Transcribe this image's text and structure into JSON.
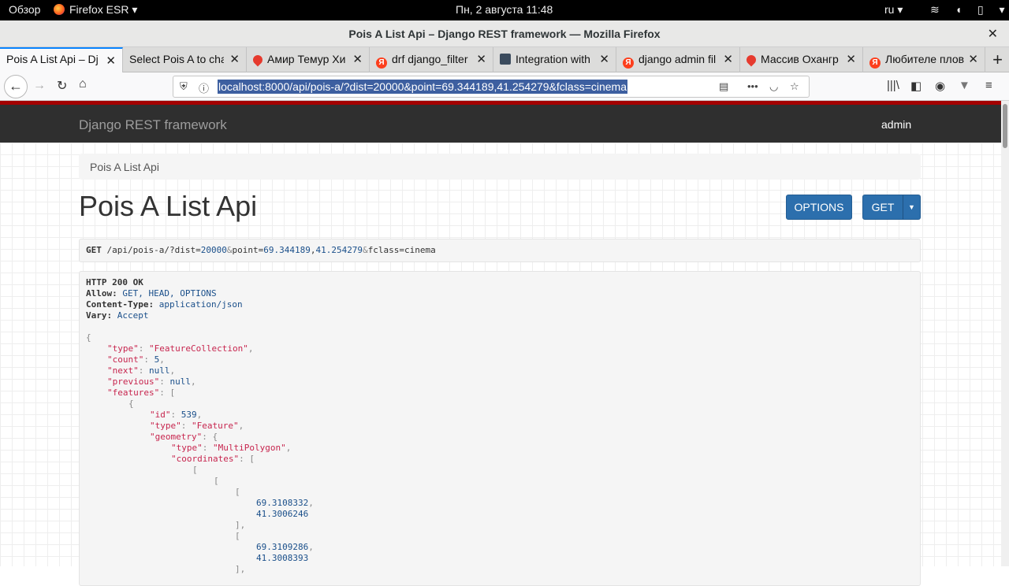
{
  "system": {
    "overview": "Обзор",
    "app": "Firefox ESR ▾",
    "clock": "Пн, 2 августа  11:48",
    "lang": "ru ▾",
    "tray": "≋ ◖ ▯ ▾"
  },
  "window": {
    "title": "Pois A List Api – Django REST framework — Mozilla Firefox",
    "close": "✕"
  },
  "tabs": [
    {
      "label": "Pois A List Api – Dj",
      "icon": "none"
    },
    {
      "label": "Select Pois A to cha",
      "icon": "none"
    },
    {
      "label": "Амир Темур Хи",
      "icon": "map-pin-icon"
    },
    {
      "label": "drf django_filter",
      "icon": "yandex-icon"
    },
    {
      "label": "Integration with",
      "icon": "document-icon"
    },
    {
      "label": "django admin fil",
      "icon": "yandex-icon"
    },
    {
      "label": "Массив Охангр",
      "icon": "map-pin-icon"
    },
    {
      "label": "Любителе плов",
      "icon": "yandex-icon"
    }
  ],
  "tab_close": "✕",
  "new_tab": "+",
  "nav": {
    "back": "←",
    "forward": "→",
    "reload": "↻",
    "home": "⌂",
    "url": "localhost:8000/api/pois-a/?dist=20000&point=69.344189,41.254279&fclass=cinema",
    "reader": "▤",
    "more": "•••",
    "pocket": "◡",
    "star": "☆",
    "library": "|||\\",
    "sidebar": "◧",
    "account": "◉",
    "extension": "▼",
    "menu": "≡"
  },
  "drf": {
    "brand": "Django REST framework",
    "user": "admin"
  },
  "page": {
    "breadcrumb": "Pois A List Api",
    "heading": "Pois A List Api",
    "options_button": "OPTIONS",
    "get_button": "GET",
    "get_caret": "▼"
  },
  "request": {
    "method": "GET",
    "path": " /api/pois-a/?dist=",
    "dist": "20000",
    "amp1": "&",
    "point_key": "point=",
    "point_a": "69.344189",
    "comma": ",",
    "point_b": "41.254279",
    "amp2": "&",
    "fclass": "fclass=cinema"
  },
  "response": {
    "status": "HTTP 200 OK",
    "allow_key": "Allow:",
    "allow_val": " GET, HEAD, OPTIONS",
    "ctype_key": "Content-Type:",
    "ctype_val": " application/json",
    "vary_key": "Vary:",
    "vary_val": " Accept",
    "json": {
      "open": "{",
      "type_key": "\"type\"",
      "type_val": "\"FeatureCollection\"",
      "count_key": "\"count\"",
      "count_val": "5",
      "next_key": "\"next\"",
      "next_val": "null",
      "previous_key": "\"previous\"",
      "previous_val": "null",
      "features_key": "\"features\"",
      "bracket": "[",
      "brace": "{",
      "id_key": "\"id\"",
      "id_val": "539",
      "ftype_key": "\"type\"",
      "ftype_val": "\"Feature\"",
      "geometry_key": "\"geometry\"",
      "gtype_key": "\"type\"",
      "gtype_val": "\"MultiPolygon\"",
      "coords_key": "\"coordinates\"",
      "c1a": "69.3108332",
      "c1b": "41.3006246",
      "close_item": "],",
      "c2a": "69.3109286",
      "c2b": "41.3008393"
    }
  },
  "colors": {
    "accent": "#0a84ff",
    "drf_bar": "#2f2f2f",
    "drf_red": "#a30000",
    "button": "#2c6fad",
    "json_string": "#c7254e",
    "json_literal": "#1a4f8a"
  }
}
